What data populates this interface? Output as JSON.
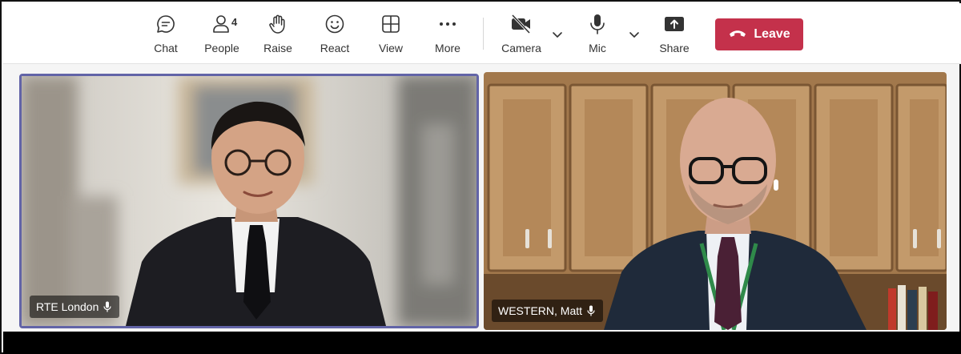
{
  "toolbar": {
    "chat_label": "Chat",
    "people_label": "People",
    "people_count": "4",
    "raise_label": "Raise",
    "react_label": "React",
    "view_label": "View",
    "more_label": "More",
    "camera_label": "Camera",
    "mic_label": "Mic",
    "share_label": "Share",
    "leave_label": "Leave"
  },
  "participants": [
    {
      "name": "RTE London",
      "active_speaker": true
    },
    {
      "name": "WESTERN, Matt",
      "active_speaker": false
    }
  ],
  "colors": {
    "leave_red": "#c4314b",
    "active_border": "#6264a7"
  }
}
